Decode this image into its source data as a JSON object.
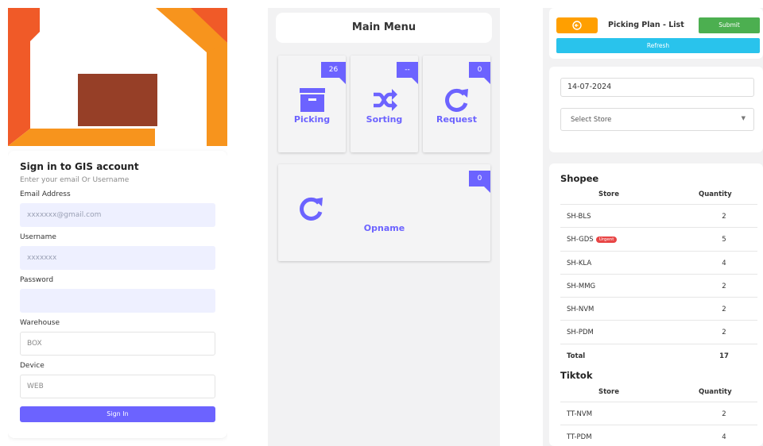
{
  "login": {
    "title": "Sign in to GIS account",
    "subtitle": "Enter your email Or Username",
    "email_label": "Email Address",
    "email_placeholder": "xxxxxxx@gmail.com",
    "username_label": "Username",
    "username_placeholder": "xxxxxxx",
    "password_label": "Password",
    "password_value": "",
    "warehouse_label": "Warehouse",
    "warehouse_value": "BOX",
    "device_label": "Device",
    "device_value": "WEB",
    "signin_label": "Sign In",
    "colors": {
      "logo_orange_dark": "#f05a28",
      "logo_orange": "#f7941d",
      "logo_brown": "#963f27",
      "primary": "#6c63ff"
    }
  },
  "menu": {
    "title": "Main Menu",
    "tiles": [
      {
        "label": "Picking",
        "badge": "26",
        "icon": "archive-box-icon"
      },
      {
        "label": "Sorting",
        "badge": "--",
        "icon": "shuffle-icon"
      },
      {
        "label": "Request",
        "badge": "0",
        "icon": "refresh-icon"
      },
      {
        "label": "Opname",
        "badge": "0",
        "icon": "refresh-icon"
      }
    ]
  },
  "picking_plan": {
    "title": "Picking Plan - List",
    "back_icon": "circle-arrow-left-icon",
    "submit_label": "Submit",
    "refresh_label": "Refresh",
    "date_value": "14-07-2024",
    "store_placeholder": "Select Store",
    "groups": [
      {
        "name": "Shopee",
        "headers": [
          "Store",
          "Quantity"
        ],
        "rows": [
          {
            "store": "SH-BLS",
            "qty": "2"
          },
          {
            "store": "SH-GDS",
            "qty": "5",
            "badge": "Urgent"
          },
          {
            "store": "SH-KLA",
            "qty": "4"
          },
          {
            "store": "SH-MMG",
            "qty": "2"
          },
          {
            "store": "SH-NVM",
            "qty": "2"
          },
          {
            "store": "SH-PDM",
            "qty": "2"
          }
        ],
        "total_label": "Total",
        "total": "17"
      },
      {
        "name": "Tiktok",
        "headers": [
          "Store",
          "Quantity"
        ],
        "rows": [
          {
            "store": "TT-NVM",
            "qty": "2"
          },
          {
            "store": "TT-PDM",
            "qty": "4"
          }
        ]
      }
    ]
  }
}
